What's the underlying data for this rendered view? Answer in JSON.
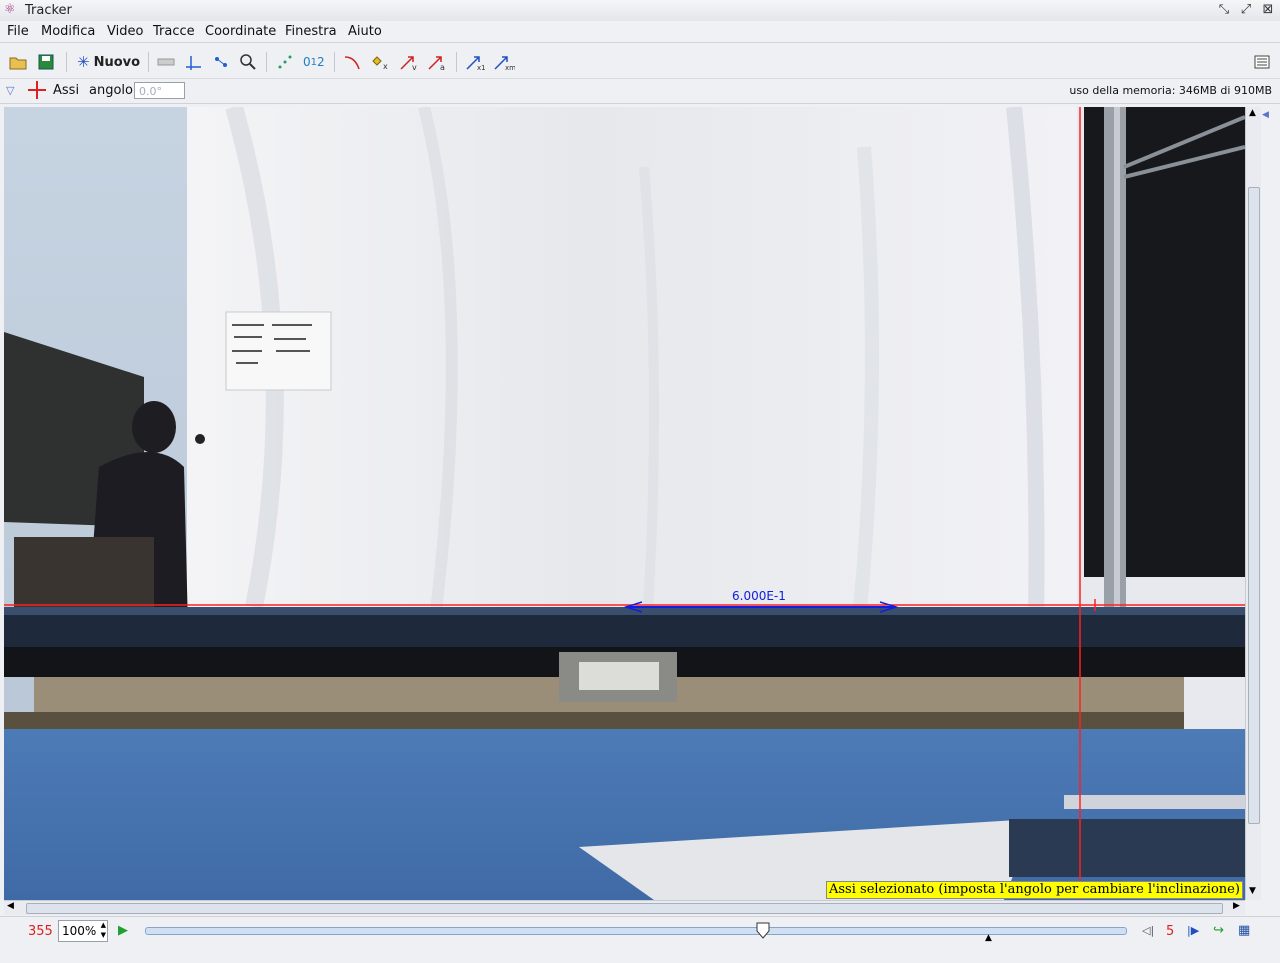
{
  "window": {
    "title": "Tracker"
  },
  "menu": [
    "File",
    "Modifica",
    "Video",
    "Tracce",
    "Coordinate",
    "Finestra",
    "Aiuto"
  ],
  "toolbar": {
    "new_label": "Nuovo"
  },
  "trackbar": {
    "track_name": "Assi",
    "angle_label": "angolo",
    "angle_value": "0.0°",
    "memory_text": "uso della memoria: 346MB di 910MB"
  },
  "video": {
    "calibration_label": "6.000E-1",
    "status_tooltip": "Assi selezionato (imposta l'angolo per cambiare l'inclinazione)"
  },
  "player": {
    "frame_number": "355",
    "zoom": "100%",
    "step_size": "5",
    "slider_position": 0.63
  },
  "colors": {
    "axis": "#ff2020",
    "calibration": "#1020e0",
    "frame_number": "#e02020"
  }
}
